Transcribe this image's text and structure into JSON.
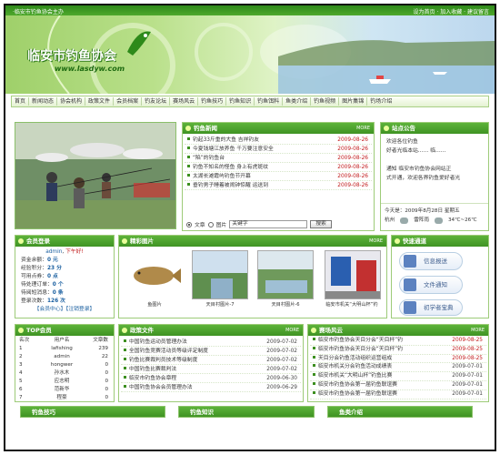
{
  "topbar": {
    "left_text": "·临安市钓鱼协会主办",
    "right_text": "设为首页 · 加入收藏 · 建议留言"
  },
  "banner": {
    "title": "临安市钓鱼协会",
    "url_text": "www.lasdyw.com"
  },
  "nav": {
    "items": [
      "首页",
      "新闻动态",
      "协会机构",
      "政策文件",
      "会员档案",
      "钓友论坛",
      "赛场风云",
      "钓鱼技巧",
      "钓鱼知识",
      "钓鱼饵料",
      "鱼类介绍",
      "钓鱼视频",
      "图片集锦",
      "钓场介绍"
    ]
  },
  "news": {
    "header": "钓鱼新闻",
    "more": "MORE",
    "items": [
      {
        "title": "钓起33斤重的大鱼  吉祥钓友",
        "date": "2009-08-26"
      },
      {
        "title": "今夏钱塘江放养鱼 千万要注意安全",
        "date": "2009-08-26"
      },
      {
        "title": "“陷”的钓鱼台",
        "date": "2009-08-26"
      },
      {
        "title": "钓鱼不知名的怪鱼  身上有虎斑纹",
        "date": "2009-08-26"
      },
      {
        "title": "太湖长滩霞屿钓鱼节开幕",
        "date": "2009-08-26"
      },
      {
        "title": "垂钓男子睡着被闹钟惊醒  运送到",
        "date": "2009-08-26"
      }
    ],
    "search": {
      "opt1": "文章",
      "opt2": "图片",
      "value": "关键字",
      "button": "搜索"
    }
  },
  "notice": {
    "header": "站点公告",
    "lines": [
      "欢迎各位钓鱼",
      "好者光临本站……    临……",
      "通知    临安市钓鱼协会网站正",
      "式开通，欢迎各界钓鱼爱好者光"
    ],
    "date_line": "今天是：2009年8月28日  星期五",
    "weather": {
      "city": "杭州",
      "desc": "雷阵雨",
      "temp": "34℃~26℃"
    }
  },
  "login": {
    "header": "会员登录",
    "user_label": "admin",
    "logout": "下午好!",
    "fields": [
      {
        "label": "资金余额：",
        "value": "0 元"
      },
      {
        "label": "经验积分：",
        "value": "23 分"
      },
      {
        "label": "可用点券：",
        "value": "0 点"
      },
      {
        "label": "待处理订单：",
        "value": "0 个"
      },
      {
        "label": "待阅短消息：",
        "value": "0 条"
      },
      {
        "label": "登录次数：",
        "value": "126 次"
      }
    ],
    "links": "【会员中心】【注销登录】"
  },
  "photos": {
    "header": "精彩图片",
    "more": "MORE",
    "items": [
      {
        "caption": "鱼图片"
      },
      {
        "caption": "天目村图片-7"
      },
      {
        "caption": "天目村图片-6"
      },
      {
        "caption": "临安市机关“大明山杯”钓"
      }
    ]
  },
  "quick": {
    "header": "快速通道",
    "buttons": [
      "信息报送",
      "文件通知",
      "初学者宝典"
    ]
  },
  "top_members": {
    "header": "TOP会员",
    "cols": [
      "名次",
      "用户名",
      "文章数"
    ],
    "rows": [
      {
        "rank": "1",
        "name": "lafishing",
        "count": "239"
      },
      {
        "rank": "2",
        "name": "admin",
        "count": "22"
      },
      {
        "rank": "3",
        "name": "hongwer",
        "count": "0"
      },
      {
        "rank": "4",
        "name": "孙水木",
        "count": "0"
      },
      {
        "rank": "5",
        "name": "应志明",
        "count": "0"
      },
      {
        "rank": "6",
        "name": "范新华",
        "count": "0"
      },
      {
        "rank": "7",
        "name": "程豪",
        "count": "0"
      }
    ]
  },
  "policy": {
    "header": "政策文件",
    "more": "MORE",
    "items": [
      {
        "title": "中国钓鱼运动员管理办法",
        "date": "2009-07-02"
      },
      {
        "title": "全国钓鱼竞赛活动员等级评定制度",
        "date": "2009-07-02"
      },
      {
        "title": "钓鱼比赛裁判员技术等级制度",
        "date": "2009-07-02"
      },
      {
        "title": "中国钓鱼比赛裁判法",
        "date": "2009-07-02"
      },
      {
        "title": "临安市钓鱼协会章程",
        "date": "2009-06-30"
      },
      {
        "title": "中国钓鱼协会会员管理办法",
        "date": "2009-06-29"
      }
    ]
  },
  "arena": {
    "header": "赛场风云",
    "more": "MORE",
    "items": [
      {
        "title": "临安市钓鱼协会天目分会“天目杯”钓",
        "date": "2009-08-25"
      },
      {
        "title": "临安市钓鱼协会天目分会“天目杯”钓",
        "date": "2009-08-25"
      },
      {
        "title": "天目分会钓鱼活动组织运营组成",
        "date": "2009-08-25"
      },
      {
        "title": "临安市机关分会钓鱼活动成绩表",
        "date": "2009-07-01"
      },
      {
        "title": "临安市机关“大明山杯”钓鱼比赛",
        "date": "2009-07-01"
      },
      {
        "title": "临安市钓鱼协会第一届钓鱼联谊赛",
        "date": "2009-07-01"
      },
      {
        "title": "临安市钓鱼协会第一届钓鱼联谊赛",
        "date": "2009-07-01"
      }
    ]
  },
  "bottom": {
    "b1": "钓鱼技巧",
    "b2": "钓鱼知识",
    "b3": "鱼类介绍"
  }
}
